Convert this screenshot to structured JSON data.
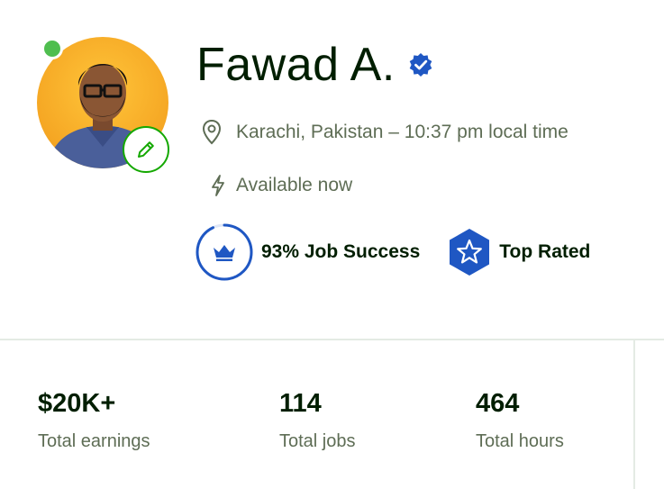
{
  "profile": {
    "name": "Fawad A.",
    "location": "Karachi, Pakistan – 10:37 pm local time",
    "availability": "Available now",
    "job_success": "93% Job Success",
    "job_success_fraction": 0.93,
    "top_rated": "Top Rated"
  },
  "stats": [
    {
      "value": "$20K+",
      "label": "Total earnings"
    },
    {
      "value": "114",
      "label": "Total jobs"
    },
    {
      "value": "464",
      "label": "Total hours"
    }
  ],
  "colors": {
    "brand_green": "#14a800",
    "online_green": "#4fbe4f",
    "badge_blue": "#1f57c3",
    "text_dark": "#001e00",
    "text_muted": "#5e6d55"
  },
  "icons": [
    "online-status-icon",
    "pencil-icon",
    "verified-check-icon",
    "location-pin-icon",
    "lightning-icon",
    "crown-icon",
    "star-icon"
  ]
}
